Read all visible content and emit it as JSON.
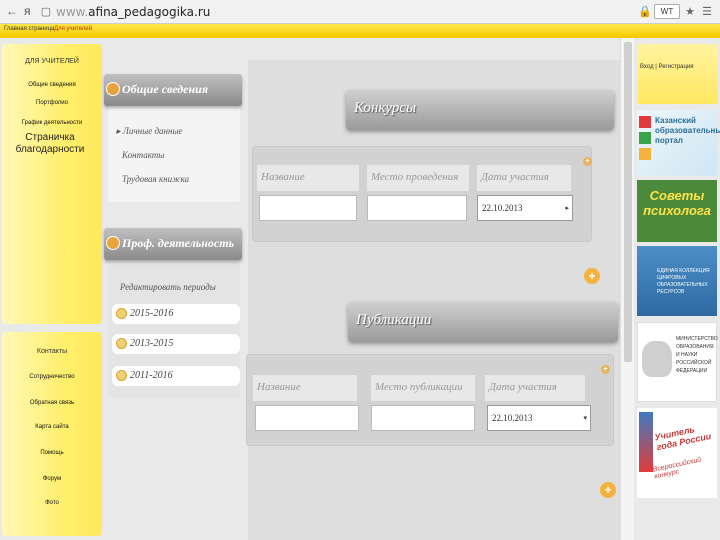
{
  "browser": {
    "nav_back": "←",
    "nav_forward": "я",
    "url_prefix": "www.",
    "url_main": "afina_pedagogika.ru",
    "translate_label": "WT"
  },
  "topbar": {
    "link1": "Главная страница",
    "link2": "Для учителей"
  },
  "left_panel_1": {
    "title": "ДЛЯ УЧИТЕЛЕЙ",
    "items": [
      "Общие сведения",
      "Портфолио",
      "График деятельности"
    ],
    "thanks": "Страничка благодарности"
  },
  "left_panel_2": {
    "title": "Контакты",
    "items": [
      "Сотрудничество",
      "Обратная связь",
      "Карта сайта",
      "Помощь",
      "Форум",
      "Фото"
    ]
  },
  "general": {
    "title": "Общие сведения",
    "links": [
      "Личные данные",
      "Контакты",
      "Трудовая книжка"
    ]
  },
  "prof": {
    "title": "Проф. деятельность",
    "edit_periods": "Редактировать периоды",
    "periods": [
      "2015-2016",
      "2013-2015",
      "2011-2016"
    ]
  },
  "contests": {
    "title": "Конкурсы",
    "col_name": "Название",
    "col_place": "Место проведения",
    "col_date": "Дата участия",
    "date_value": "22.10.2013"
  },
  "publications": {
    "title": "Публикации",
    "col_name": "Название",
    "col_place": "Место публикации",
    "col_date": "Дата участия",
    "date_value": "22.10.2013"
  },
  "right": {
    "login": "Вход | Регистрация",
    "banner1": "Казанский образовательный портал",
    "banner2": "Советы психолога",
    "banner3": "ЕДИНАЯ КОЛЛЕКЦИЯ ЦИФРОВЫХ ОБРАЗОВАТЕЛЬНЫХ РЕСУРСОВ",
    "banner4": "МИНИСТЕРСТВО ОБРАЗОВАНИЯ И НАУКИ РОССИЙСКОЙ ФЕДЕРАЦИИ",
    "banner5_line1": "Учитель года России",
    "banner5_line2": "Всероссийский конкурс"
  },
  "colors": {
    "yellow": "#ffe74a",
    "orange": "#f5b23c",
    "gray_bar": "#9a9a9a"
  }
}
